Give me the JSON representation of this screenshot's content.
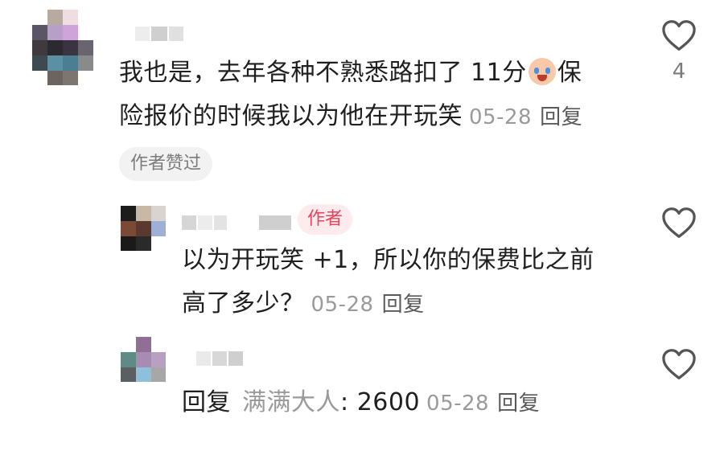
{
  "comments": [
    {
      "text_line1_a": "我也是，去年各种不熟悉路扣了 11分",
      "emoji": "crying-laughing-face",
      "text_line1_b": "保",
      "text_line2": "险报价的时候我以为他在开玩笑",
      "date": "05-28",
      "reply_label": "回复",
      "liked_by_author": "作者赞过",
      "like_count": "4"
    },
    {
      "author_badge": "作者",
      "text_line1": "以为开玩笑 +1，所以你的保费比之前",
      "text_line2": "高了多少？",
      "date": "05-28",
      "reply_label": "回复"
    },
    {
      "reply_prefix": "回复",
      "reply_to": "满满大人",
      "text": ": 2600",
      "date": "05-28",
      "reply_label": "回复"
    }
  ],
  "colors": {
    "text": "#1f1f1f",
    "meta": "#9a9a9a",
    "author_badge_bg": "#fdebee",
    "author_badge_text": "#e8435a",
    "pill_bg": "#f2f2f2"
  },
  "icons": [
    "heart-outline-icon"
  ]
}
